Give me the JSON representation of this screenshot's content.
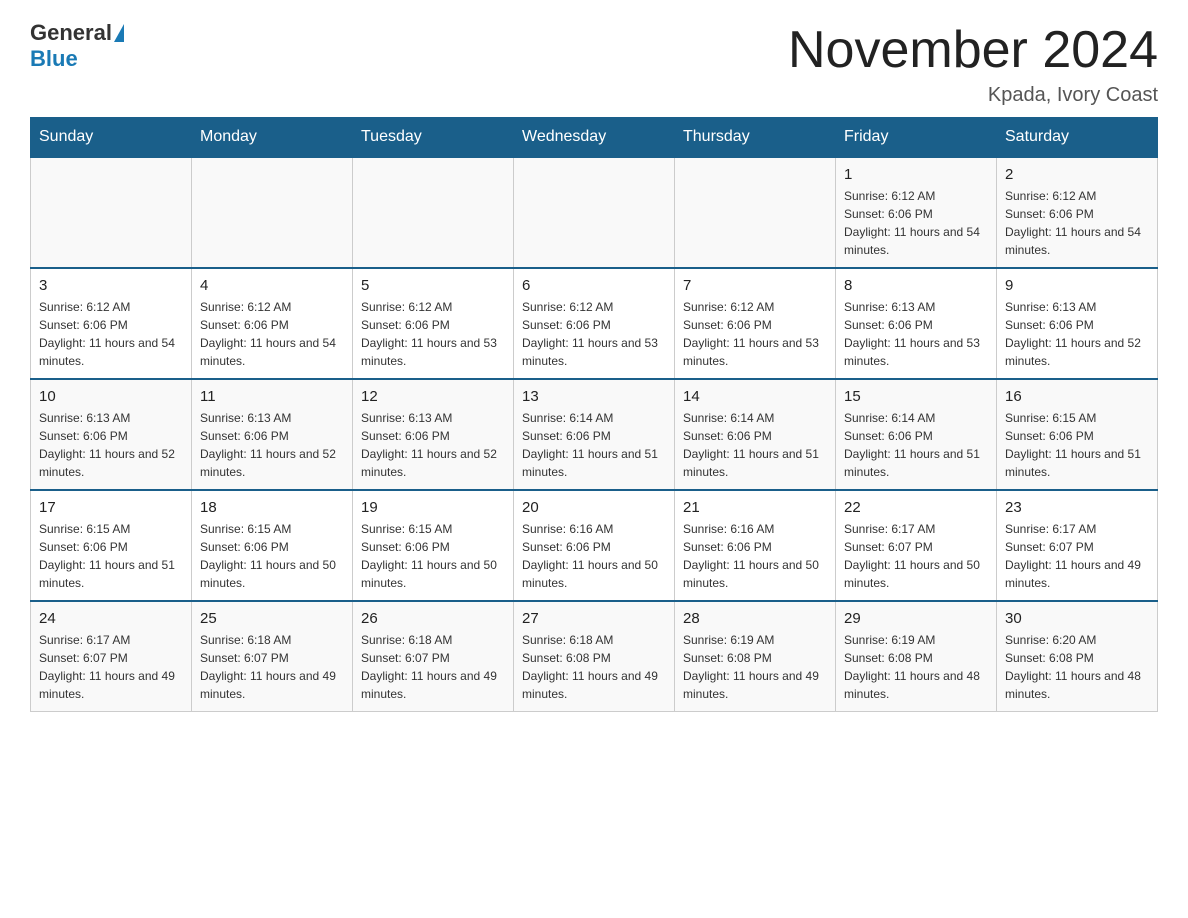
{
  "header": {
    "logo_general": "General",
    "logo_blue": "Blue",
    "month_title": "November 2024",
    "location": "Kpada, Ivory Coast"
  },
  "weekdays": [
    "Sunday",
    "Monday",
    "Tuesday",
    "Wednesday",
    "Thursday",
    "Friday",
    "Saturday"
  ],
  "weeks": [
    [
      {
        "day": "",
        "info": ""
      },
      {
        "day": "",
        "info": ""
      },
      {
        "day": "",
        "info": ""
      },
      {
        "day": "",
        "info": ""
      },
      {
        "day": "",
        "info": ""
      },
      {
        "day": "1",
        "info": "Sunrise: 6:12 AM\nSunset: 6:06 PM\nDaylight: 11 hours and 54 minutes."
      },
      {
        "day": "2",
        "info": "Sunrise: 6:12 AM\nSunset: 6:06 PM\nDaylight: 11 hours and 54 minutes."
      }
    ],
    [
      {
        "day": "3",
        "info": "Sunrise: 6:12 AM\nSunset: 6:06 PM\nDaylight: 11 hours and 54 minutes."
      },
      {
        "day": "4",
        "info": "Sunrise: 6:12 AM\nSunset: 6:06 PM\nDaylight: 11 hours and 54 minutes."
      },
      {
        "day": "5",
        "info": "Sunrise: 6:12 AM\nSunset: 6:06 PM\nDaylight: 11 hours and 53 minutes."
      },
      {
        "day": "6",
        "info": "Sunrise: 6:12 AM\nSunset: 6:06 PM\nDaylight: 11 hours and 53 minutes."
      },
      {
        "day": "7",
        "info": "Sunrise: 6:12 AM\nSunset: 6:06 PM\nDaylight: 11 hours and 53 minutes."
      },
      {
        "day": "8",
        "info": "Sunrise: 6:13 AM\nSunset: 6:06 PM\nDaylight: 11 hours and 53 minutes."
      },
      {
        "day": "9",
        "info": "Sunrise: 6:13 AM\nSunset: 6:06 PM\nDaylight: 11 hours and 52 minutes."
      }
    ],
    [
      {
        "day": "10",
        "info": "Sunrise: 6:13 AM\nSunset: 6:06 PM\nDaylight: 11 hours and 52 minutes."
      },
      {
        "day": "11",
        "info": "Sunrise: 6:13 AM\nSunset: 6:06 PM\nDaylight: 11 hours and 52 minutes."
      },
      {
        "day": "12",
        "info": "Sunrise: 6:13 AM\nSunset: 6:06 PM\nDaylight: 11 hours and 52 minutes."
      },
      {
        "day": "13",
        "info": "Sunrise: 6:14 AM\nSunset: 6:06 PM\nDaylight: 11 hours and 51 minutes."
      },
      {
        "day": "14",
        "info": "Sunrise: 6:14 AM\nSunset: 6:06 PM\nDaylight: 11 hours and 51 minutes."
      },
      {
        "day": "15",
        "info": "Sunrise: 6:14 AM\nSunset: 6:06 PM\nDaylight: 11 hours and 51 minutes."
      },
      {
        "day": "16",
        "info": "Sunrise: 6:15 AM\nSunset: 6:06 PM\nDaylight: 11 hours and 51 minutes."
      }
    ],
    [
      {
        "day": "17",
        "info": "Sunrise: 6:15 AM\nSunset: 6:06 PM\nDaylight: 11 hours and 51 minutes."
      },
      {
        "day": "18",
        "info": "Sunrise: 6:15 AM\nSunset: 6:06 PM\nDaylight: 11 hours and 50 minutes."
      },
      {
        "day": "19",
        "info": "Sunrise: 6:15 AM\nSunset: 6:06 PM\nDaylight: 11 hours and 50 minutes."
      },
      {
        "day": "20",
        "info": "Sunrise: 6:16 AM\nSunset: 6:06 PM\nDaylight: 11 hours and 50 minutes."
      },
      {
        "day": "21",
        "info": "Sunrise: 6:16 AM\nSunset: 6:06 PM\nDaylight: 11 hours and 50 minutes."
      },
      {
        "day": "22",
        "info": "Sunrise: 6:17 AM\nSunset: 6:07 PM\nDaylight: 11 hours and 50 minutes."
      },
      {
        "day": "23",
        "info": "Sunrise: 6:17 AM\nSunset: 6:07 PM\nDaylight: 11 hours and 49 minutes."
      }
    ],
    [
      {
        "day": "24",
        "info": "Sunrise: 6:17 AM\nSunset: 6:07 PM\nDaylight: 11 hours and 49 minutes."
      },
      {
        "day": "25",
        "info": "Sunrise: 6:18 AM\nSunset: 6:07 PM\nDaylight: 11 hours and 49 minutes."
      },
      {
        "day": "26",
        "info": "Sunrise: 6:18 AM\nSunset: 6:07 PM\nDaylight: 11 hours and 49 minutes."
      },
      {
        "day": "27",
        "info": "Sunrise: 6:18 AM\nSunset: 6:08 PM\nDaylight: 11 hours and 49 minutes."
      },
      {
        "day": "28",
        "info": "Sunrise: 6:19 AM\nSunset: 6:08 PM\nDaylight: 11 hours and 49 minutes."
      },
      {
        "day": "29",
        "info": "Sunrise: 6:19 AM\nSunset: 6:08 PM\nDaylight: 11 hours and 48 minutes."
      },
      {
        "day": "30",
        "info": "Sunrise: 6:20 AM\nSunset: 6:08 PM\nDaylight: 11 hours and 48 minutes."
      }
    ]
  ]
}
